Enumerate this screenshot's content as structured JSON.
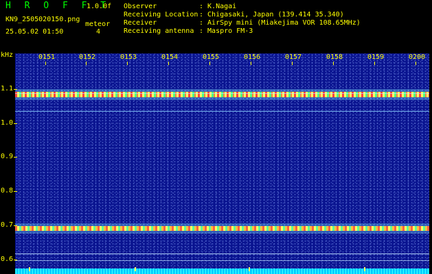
{
  "header": {
    "title": "H R O F F T",
    "version": "1.0.0f",
    "file_name": "KN9_2505020150.png",
    "meteor_label": "meteor",
    "date_time": "25.05.02 01:50",
    "meteor_count": "4"
  },
  "station": [
    {
      "label": "Observer",
      "value": ": K.Nagai"
    },
    {
      "label": "Receiving Location",
      "value": ": Chigasaki, Japan (139.414 35.340)"
    },
    {
      "label": "Receiver",
      "value": ": AirSpy mini (Miakejima VOR 108.65MHz)"
    },
    {
      "label": "Receiving antenna",
      "value": ": Maspro FM-3"
    }
  ],
  "y_axis": {
    "unit": "kHz",
    "ticks": [
      "1.1",
      "1.0",
      "0.9",
      "0.8",
      "0.7",
      "0.6"
    ]
  },
  "x_axis": {
    "ticks": [
      "0151",
      "0152",
      "0153",
      "0154",
      "0155",
      "0156",
      "0157",
      "0158",
      "0159",
      "0200"
    ]
  },
  "colors": {
    "label": "#ffff00",
    "title": "#00ff00",
    "spectrogram_bg": "#0a1490"
  }
}
